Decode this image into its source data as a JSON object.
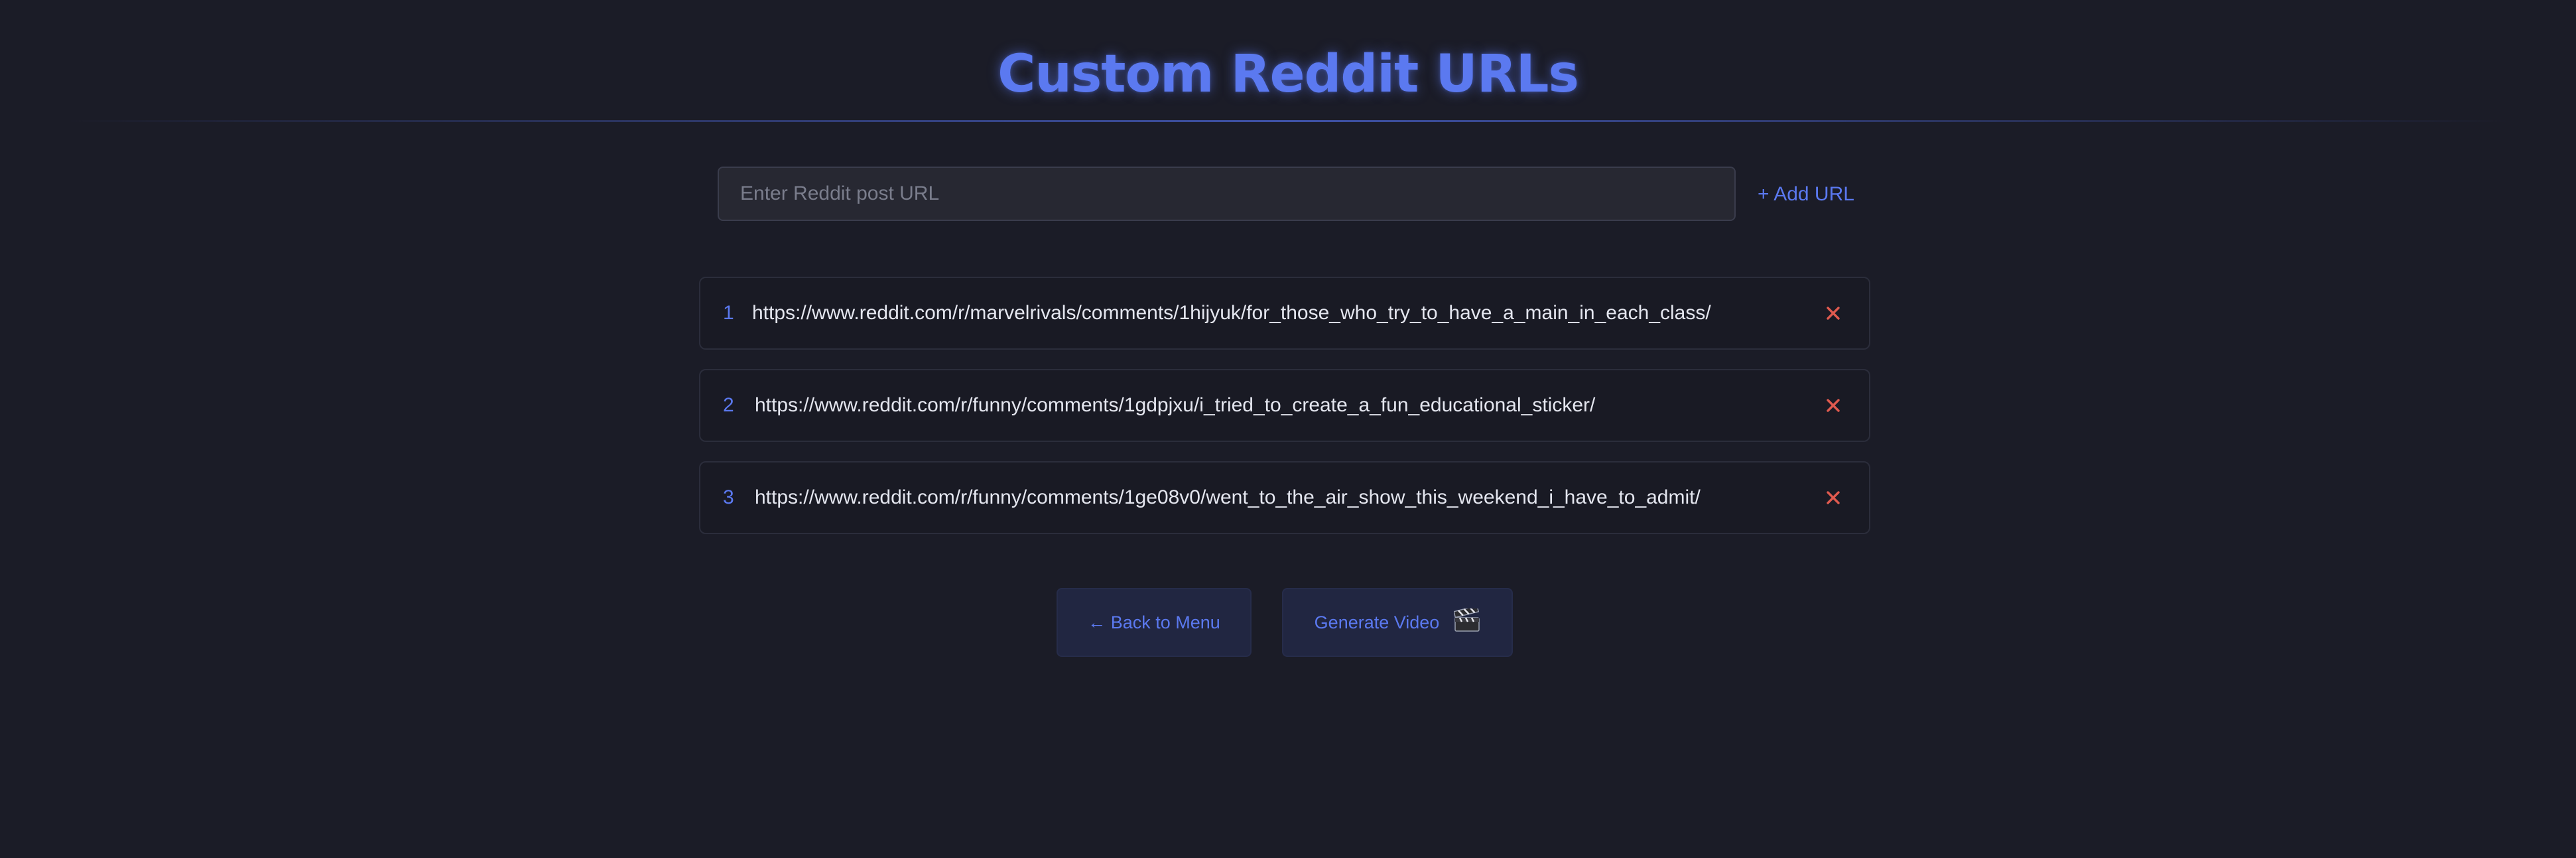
{
  "header": {
    "title": "Custom Reddit URLs"
  },
  "input": {
    "placeholder": "Enter Reddit post URL",
    "value": "",
    "add_label": "+ Add URL"
  },
  "urls": [
    {
      "index": "1",
      "url": "https://www.reddit.com/r/marvelrivals/comments/1hijyuk/for_those_who_try_to_have_a_main_in_each_class/"
    },
    {
      "index": "2",
      "url": "https://www.reddit.com/r/funny/comments/1gdpjxu/i_tried_to_create_a_fun_educational_sticker/"
    },
    {
      "index": "3",
      "url": "https://www.reddit.com/r/funny/comments/1ge08v0/went_to_the_air_show_this_weekend_i_have_to_admit/"
    }
  ],
  "actions": {
    "back_label": "← Back to Menu",
    "generate_label": "Generate Video",
    "generate_icon": "clapperboard-icon"
  },
  "colors": {
    "background": "#1b1c27",
    "accent": "#5b79f0",
    "remove": "#e05a4f"
  }
}
